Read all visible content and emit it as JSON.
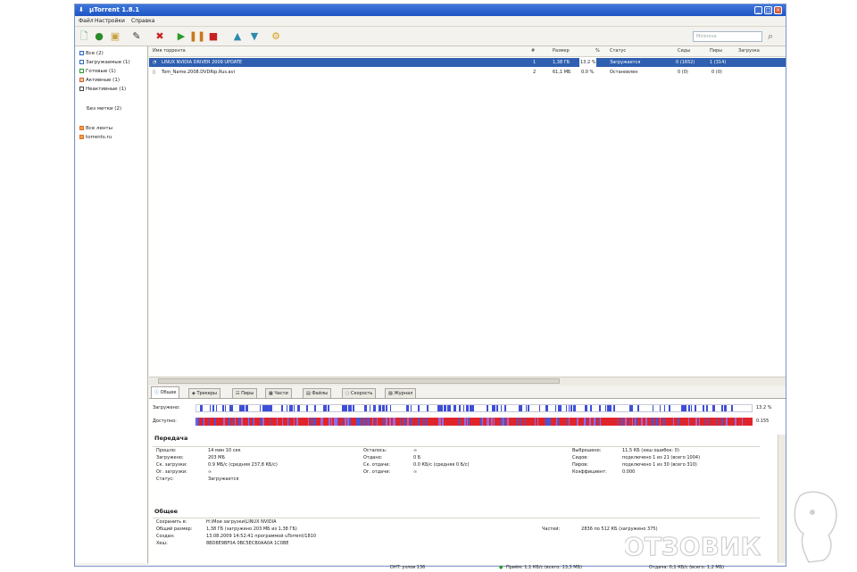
{
  "window": {
    "title": "µTorrent 1.8.1"
  },
  "menu": [
    "Файл",
    "Настройки",
    "Справка"
  ],
  "search": {
    "placeholder": "Mininova"
  },
  "sidebar": {
    "items": [
      {
        "label": "Все (2)"
      },
      {
        "label": "Загружаемые (1)"
      },
      {
        "label": "Готовые (1)"
      },
      {
        "label": "Активные (1)"
      },
      {
        "label": "Неактивные (1)"
      }
    ],
    "labels_header": "Без метки (2)",
    "feeds": [
      {
        "label": "Все ленты"
      },
      {
        "label": "torrents.ru"
      }
    ]
  },
  "list": {
    "columns": [
      "Имя торрента",
      "#",
      "Размер",
      "%",
      "Статус",
      "Сиды",
      "Пиры",
      "Загрузка"
    ],
    "rows": [
      {
        "name": "LINUX NVIDIA DRIVER 2009 UPDATE",
        "num": "1",
        "size": "1,38 ГБ",
        "pct": "13.2 %",
        "status": "Загружается",
        "seeds": "0 (1652)",
        "peers": "1 (314)"
      },
      {
        "name": "Tom_Name.2008.DVDRip.Rus.avi",
        "num": "2",
        "size": "61,1 МБ",
        "pct": "0.0 %",
        "status": "Остановлен",
        "seeds": "0 (0)",
        "peers": "0 (0)"
      }
    ]
  },
  "tabs": [
    "Общее",
    "Трекеры",
    "Пиры",
    "Части",
    "Файлы",
    "Скорость",
    "Журнал"
  ],
  "detail": {
    "downloaded_label": "Загружено:",
    "availability_label": "Доступно:",
    "downloaded_value": "13.2 %",
    "availability_value": "0.155",
    "transfer_title": "Передача",
    "transfer": [
      {
        "label": "Прошло:",
        "value": "14 мин 10 сек"
      },
      {
        "label": "Загружено:",
        "value": "203 МБ"
      },
      {
        "label": "Ск. загрузки:",
        "value": "0.9 МБ/с (средняя 237,8 КБ/с)"
      },
      {
        "label": "Ог. загрузки:",
        "value": "∞"
      },
      {
        "label": "Статус:",
        "value": "Загружается"
      }
    ],
    "transfer_mid": [
      {
        "label": "Осталось:",
        "value": "∞"
      },
      {
        "label": "Отдано:",
        "value": "0 Б"
      },
      {
        "label": "Ск. отдачи:",
        "value": "0.0 КБ/с (средняя 0 Б/с)"
      },
      {
        "label": "Ог. отдачи:",
        "value": "∞"
      }
    ],
    "transfer_right": [
      {
        "label": "Выброшено:",
        "value": "11,5 КБ (хеш ошибок: 0)"
      },
      {
        "label": "Сидов:",
        "value": "подключено 1 из 21 (всего 1004)"
      },
      {
        "label": "Пиров:",
        "value": "подключено 1 из 30 (всего 310)"
      },
      {
        "label": "Коэффициент:",
        "value": "0.000"
      }
    ],
    "general_title": "Общее",
    "general": [
      {
        "label": "Сохранить в:",
        "value": "H:\\Мои загрузки\\LINUX NVIDIA"
      },
      {
        "label": "Общий размер:",
        "value": "1,38 ГБ (загружено 203 МБ из 1,38 ГБ)"
      },
      {
        "label": "Создан:",
        "value": "13.08.2009 14:52:41 программой uTorrent/1810"
      },
      {
        "label": "Хеш:",
        "value": "8BD8E9BF0A 0BC5ECB0AA0A 1C0BE"
      }
    ],
    "general_right": {
      "label": "Частей:",
      "value": "2836 по 512 КБ (загружено 375)"
    }
  },
  "status": {
    "dht": "DHT: узлов 136",
    "in": "Приём: 1,1 КБ/с (всего: 13,3 МБ)",
    "out": "Отдача: 0,1 КБ/с (всего: 1,2 МБ)"
  },
  "watermark": {
    "text": "ОТЗОВИК"
  },
  "colors": {
    "accent": "#2e5fb0",
    "titlebar": "#1f54c4",
    "progress_blue": "#3e4fd6",
    "availability_red": "#e0252a"
  }
}
